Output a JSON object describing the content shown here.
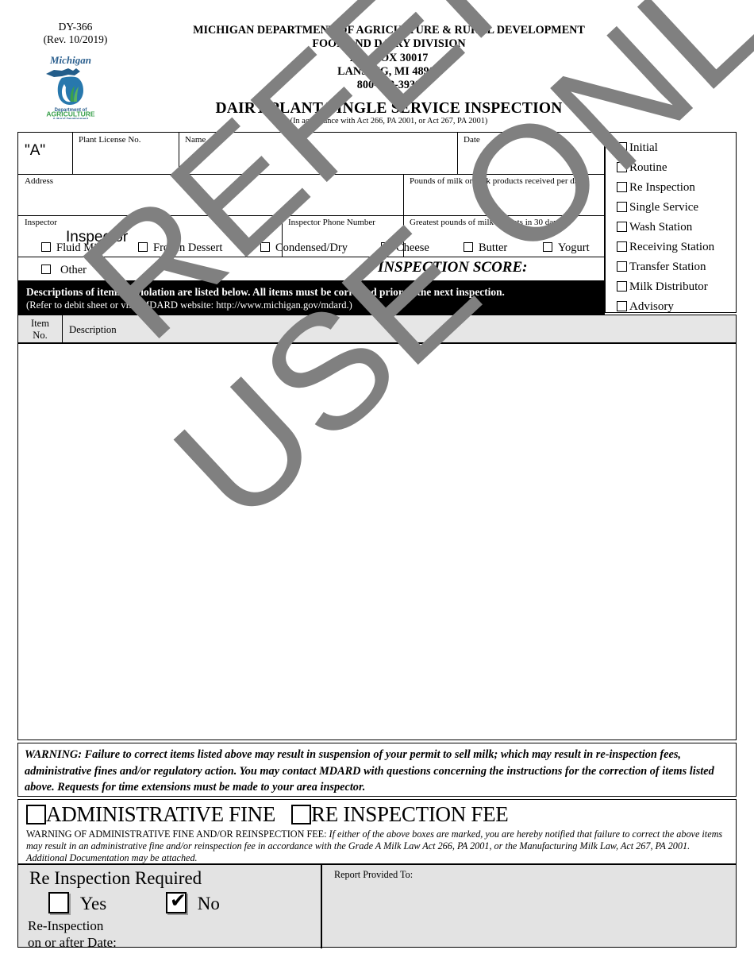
{
  "header": {
    "form_code": "DY-366",
    "revision": "(Rev. 10/2019)",
    "agency_lines": [
      "MICHIGAN DEPARTMENT OF AGRICULTURE & RURAL DEVELOPMENT",
      "FOOD AND DAIRY DIVISION",
      "P.O. BOX 30017",
      "LANSING, MI 48909",
      "800-292-3939"
    ],
    "title": "DAIRY PLANT/SINGLE SERVICE INSPECTION",
    "subtitle": "(In accordance with Act 266, PA 2001, or Act 267, PA 2001)",
    "logo": {
      "wordmark": "Michigan",
      "dept_line1": "Department of",
      "dept_line2": "AGRICULTURE",
      "dept_line3": "& Rural Development",
      "color_blue": "#1f6191",
      "color_green": "#2f9e4f",
      "color_dark": "#2b4c6f"
    }
  },
  "identity": {
    "grade_value": "\"A\"",
    "plant_license_label": "Plant License No.",
    "plant_license_value": "",
    "name_label": "Name",
    "name_value": "",
    "date_label": "Date",
    "date_value": "",
    "address_label": "Address",
    "address_value": "",
    "pounds_per_day_label": "Pounds of milk or milk products received per day",
    "pounds_per_day_value": "",
    "inspector_label": "Inspector",
    "inspector_value": "Inspector",
    "inspector_phone_label": "Inspector Phone Number",
    "inspector_phone_value": "",
    "greatest_pounds_label": "Greatest pounds of milk receipts in 30 days",
    "greatest_pounds_value": ""
  },
  "inspection_types": [
    {
      "label": "Initial",
      "checked": false
    },
    {
      "label": "Routine",
      "checked": false
    },
    {
      "label": "Re Inspection",
      "checked": false
    },
    {
      "label": "Single Service",
      "checked": false
    },
    {
      "label": "Wash Station",
      "checked": false
    },
    {
      "label": "Receiving  Station",
      "checked": false
    },
    {
      "label": "Transfer Station",
      "checked": false
    },
    {
      "label": "Milk Distributor",
      "checked": false
    },
    {
      "label": "Advisory",
      "checked": false
    }
  ],
  "products": [
    {
      "label": "Fluid Milk",
      "checked": false
    },
    {
      "label": "Frozen Dessert",
      "checked": false
    },
    {
      "label": "Condensed/Dry",
      "checked": false
    },
    {
      "label": "Cheese",
      "checked": false
    },
    {
      "label": "Butter",
      "checked": false
    },
    {
      "label": "Yogurt",
      "checked": false
    },
    {
      "label": "Other",
      "checked": false
    }
  ],
  "score": {
    "label": "INSPECTION SCORE:",
    "value": ""
  },
  "notice_bar": {
    "line1": "Descriptions of items in violation are listed below. All items must be corrected prior to the next inspection.",
    "line2": "(Refer to debit sheet or visit MDARD website: http://www.michigan.gov/mdard.)"
  },
  "violations_table": {
    "col_item_line1": "Item",
    "col_item_line2": "No.",
    "col_description": "Description",
    "rows": []
  },
  "warning": {
    "text": "WARNING:  Failure to correct items listed above may result in suspension of your permit to sell milk; which may result in re-inspection fees, administrative fines and/or regulatory action. You may contact MDARD with questions concerning the instructions for the correction of items listed above.  Requests for time extensions must be made to your area inspector."
  },
  "fines": {
    "admin_fine_label": "ADMINISTRATIVE FINE",
    "admin_fine_checked": false,
    "reinspection_fee_label": "RE INSPECTION FEE",
    "reinspection_fee_checked": false,
    "note_caps": "WARNING OF ADMINISTRATIVE FINE AND/OR REINSPECTION FEE:",
    "note_italic": " If either of the above boxes are marked, you are hereby notified that failure to correct the above items may result in an administrative fine and/or reinspection fee in accordance with the Grade A Milk Law Act 266, PA 2001, or the Manufacturing Milk Law, Act 267, PA 2001. Additional Documentation may be attached."
  },
  "reinspection": {
    "title": "Re Inspection Required",
    "yes_label": "Yes",
    "yes_checked": false,
    "no_label": "No",
    "no_checked": true,
    "check_glyph": "✔",
    "date_line1": "Re-Inspection",
    "date_line2": "on or after Date:",
    "date_value": "",
    "report_to_label": "Report Provided To:",
    "report_to_value": ""
  },
  "watermark": {
    "line1": "REFERENCE",
    "line2": "USE ONLY",
    "color": "#808080"
  }
}
